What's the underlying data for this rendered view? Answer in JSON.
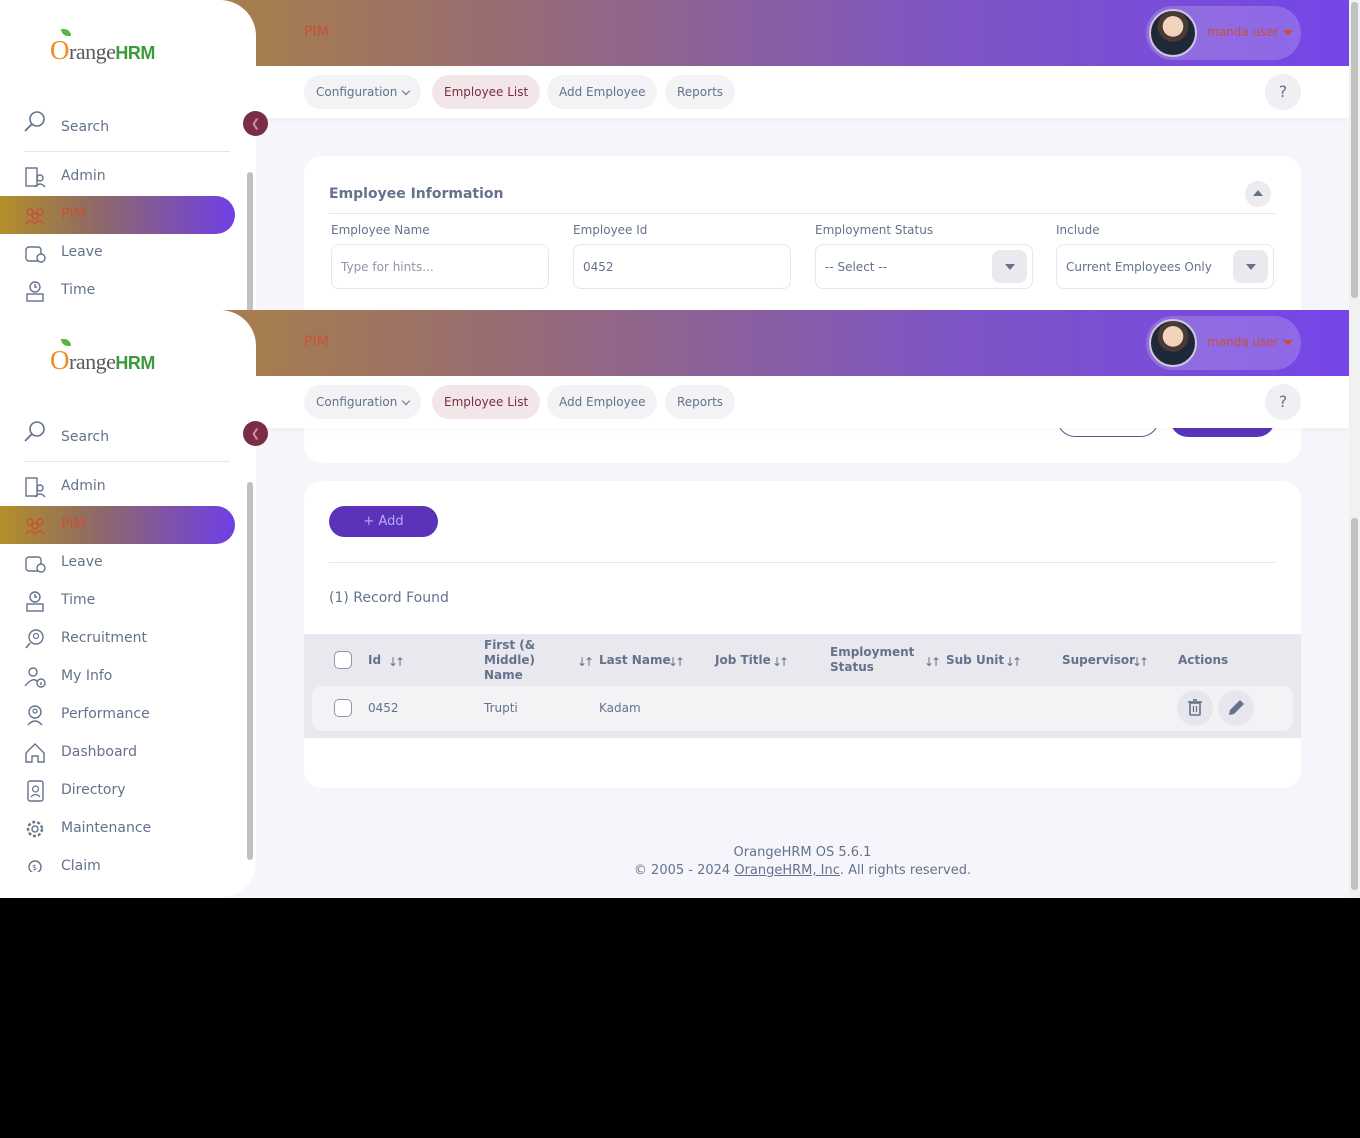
{
  "app": {
    "brand": "OrangeHRM",
    "module_title": "PIM",
    "user_name": "manda user",
    "help_label": "?"
  },
  "sidebar": {
    "search_label": "Search",
    "items": [
      {
        "label": "Admin",
        "icon": "admin-icon"
      },
      {
        "label": "PIM",
        "icon": "pim-icon",
        "active": true
      },
      {
        "label": "Leave",
        "icon": "leave-icon"
      },
      {
        "label": "Time",
        "icon": "time-icon"
      },
      {
        "label": "Recruitment",
        "icon": "recruitment-icon"
      },
      {
        "label": "My Info",
        "icon": "my-info-icon"
      },
      {
        "label": "Performance",
        "icon": "performance-icon"
      },
      {
        "label": "Dashboard",
        "icon": "dashboard-icon"
      },
      {
        "label": "Directory",
        "icon": "directory-icon"
      },
      {
        "label": "Maintenance",
        "icon": "maintenance-icon"
      },
      {
        "label": "Claim",
        "icon": "claim-icon"
      }
    ]
  },
  "tabs": [
    {
      "label": "Configuration",
      "dropdown": true
    },
    {
      "label": "Employee List",
      "active": true
    },
    {
      "label": "Add Employee"
    },
    {
      "label": "Reports"
    }
  ],
  "filter": {
    "title": "Employee Information",
    "fields": [
      {
        "label": "Employee Name",
        "placeholder": "Type for hints..."
      },
      {
        "label": "Employee Id",
        "value": "0452"
      },
      {
        "label": "Employment Status",
        "value": "-- Select --"
      },
      {
        "label": "Include",
        "value": "Current Employees Only"
      }
    ]
  },
  "list": {
    "add_label": "+ Add",
    "record_count": "(1) Record Found",
    "columns": [
      "Id",
      "First (& Middle) Name",
      "Last Name",
      "Job Title",
      "Employment Status",
      "Sub Unit",
      "Supervisor",
      "Actions"
    ],
    "rows": [
      {
        "id": "0452",
        "first_middle": "Trupti",
        "last": "Kadam",
        "job_title": "",
        "employment_status": "",
        "sub_unit": "",
        "supervisor": ""
      }
    ]
  },
  "footer": {
    "version": "OrangeHRM OS 5.6.1",
    "copyright_prefix": "© 2005 - 2024 ",
    "company_link": "OrangeHRM, Inc",
    "copyright_suffix": ". All rights reserved."
  },
  "colors": {
    "accent_purple": "#5a33b8",
    "brand_orange": "#f28c1e",
    "active_text": "#c7503a"
  }
}
